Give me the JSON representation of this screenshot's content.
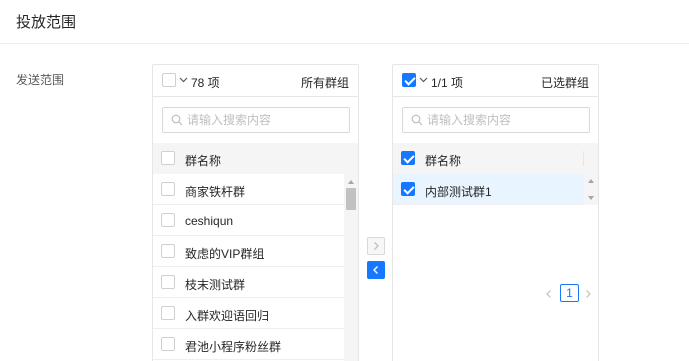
{
  "page": {
    "title": "投放范围",
    "field_label": "发送范围"
  },
  "left_panel": {
    "count": "78 项",
    "title": "所有群组",
    "search_placeholder": "请输入搜索内容",
    "column_header": "群名称",
    "rows": [
      "商家铁杆群",
      "ceshiqun",
      "致虑的VIP群组",
      "枝末测试群",
      "入群欢迎语回归",
      "君池小程序粉丝群"
    ]
  },
  "right_panel": {
    "count": "1/1 项",
    "title": "已选群组",
    "search_placeholder": "请输入搜索内容",
    "column_header": "群名称",
    "rows": [
      "内部测试群1"
    ],
    "current_page": "1"
  },
  "colors": {
    "accent": "#1677ff",
    "selected_row": "#e8f4ff"
  },
  "icons": [
    "chevron-down-icon",
    "search-icon",
    "arrow-right-icon",
    "arrow-left-icon",
    "chevron-left-icon",
    "chevron-right-icon"
  ]
}
